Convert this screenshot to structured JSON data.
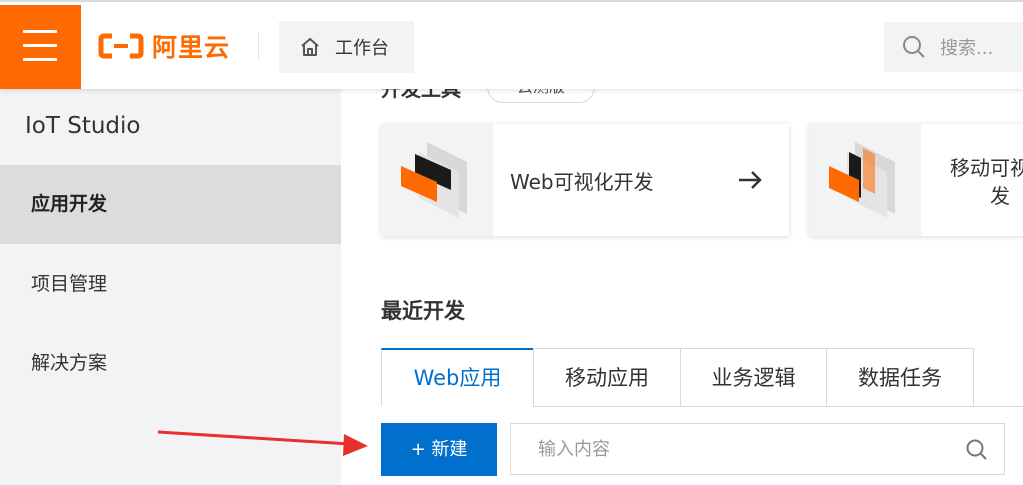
{
  "topbar": {
    "logo_text": "阿里云",
    "workbench_label": "工作台",
    "search_placeholder": "搜索..."
  },
  "sidebar": {
    "title": "IoT Studio",
    "items": [
      {
        "label": "应用开发",
        "active": true
      },
      {
        "label": "项目管理",
        "active": false
      },
      {
        "label": "解决方案",
        "active": false
      }
    ]
  },
  "main": {
    "dev_tools": {
      "title": "开发工具",
      "badge": "云测版",
      "cards": [
        {
          "name": "Web可视化开发",
          "icon": "web-visual-dev-icon"
        },
        {
          "name_line1": "移动可视化",
          "name_line2": "发",
          "icon": "mobile-visual-dev-icon"
        }
      ]
    },
    "recent": {
      "title": "最近开发",
      "tabs": [
        "Web应用",
        "移动应用",
        "业务逻辑",
        "数据任务"
      ],
      "active_tab": 0,
      "new_button": "+ 新建",
      "search_placeholder": "输入内容"
    }
  },
  "colors": {
    "brand": "#ff6a00",
    "primary": "#0070cc",
    "annotation_arrow": "#e8312f"
  }
}
